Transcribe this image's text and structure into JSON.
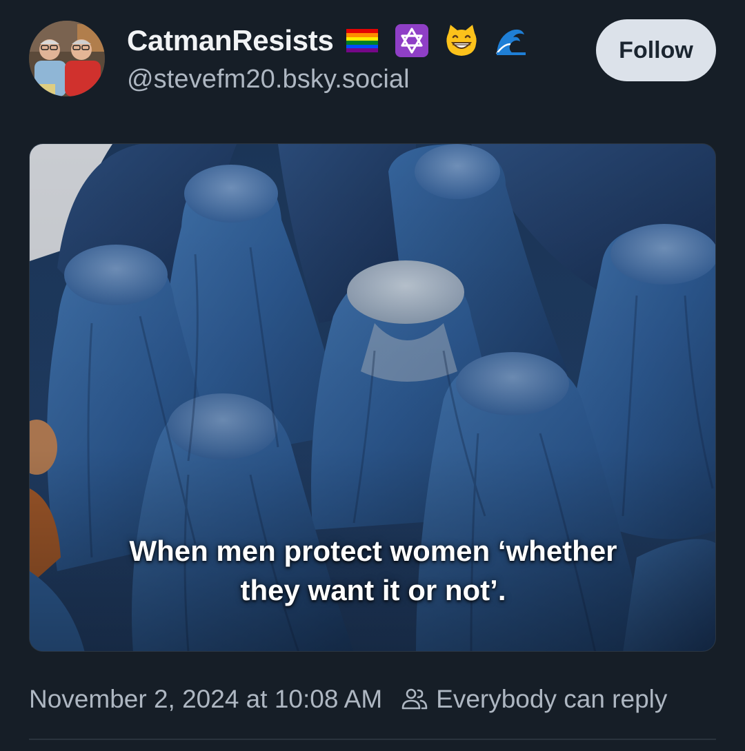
{
  "post": {
    "author": {
      "display_name": "CatmanResists",
      "handle": "@stevefm20.bsky.social",
      "badges": [
        "rainbow-flag",
        "star-of-david",
        "grinning-cat",
        "water-wave"
      ]
    },
    "follow_label": "Follow",
    "image": {
      "caption_line1": "When men protect women ‘whether",
      "caption_line2": "they want it or not’."
    },
    "timestamp": "November 2, 2024 at 10:08 AM",
    "reply_setting": "Everybody can reply"
  },
  "colors": {
    "background": "#161e27",
    "follow_button": "#dce2ea",
    "muted_text": "#aeb7c2",
    "burqa_blue": "#2e5a8e"
  }
}
